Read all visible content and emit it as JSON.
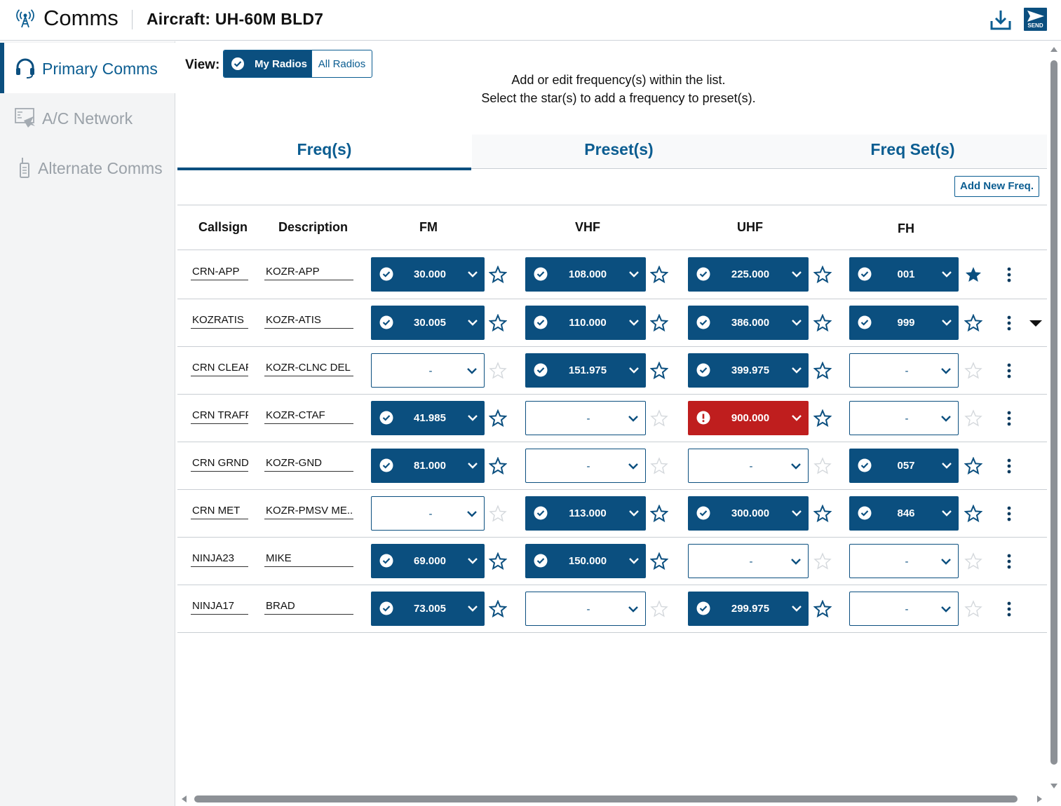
{
  "header": {
    "app_title": "Comms",
    "aircraft": "Aircraft: UH-60M BLD7",
    "send_label": "SEND",
    "icons": [
      "antenna-icon",
      "download-icon",
      "send-icon"
    ]
  },
  "sidebar": {
    "items": [
      {
        "label": "Primary Comms",
        "active": true,
        "icon": "headset-icon"
      },
      {
        "label": "A/C Network",
        "active": false,
        "icon": "network-icon"
      },
      {
        "label": "Alternate Comms",
        "active": false,
        "icon": "radio-handset-icon"
      }
    ]
  },
  "view": {
    "label": "View:",
    "options": [
      "My Radios",
      "All Radios"
    ],
    "selected": "My Radios"
  },
  "instructions": {
    "line1": "Add or edit frequency(s) within the list.",
    "line2": "Select the star(s) to add a frequency to preset(s)."
  },
  "tabs": [
    "Freq(s)",
    "Preset(s)",
    "Freq Set(s)"
  ],
  "active_tab": "Freq(s)",
  "add_button": "Add New Freq.",
  "columns": [
    "Callsign",
    "Description",
    "FM",
    "VHF",
    "UHF",
    "FH"
  ],
  "colors": {
    "primary": "#0b4f7f",
    "error": "#bf1e1e",
    "inactive": "#9aa1a8"
  },
  "rows": [
    {
      "callsign": "CRN-APP",
      "description": "KOZR-APP",
      "fm": {
        "value": "30.000",
        "state": "set",
        "starred": false
      },
      "vhf": {
        "value": "108.000",
        "state": "set",
        "starred": false
      },
      "uhf": {
        "value": "225.000",
        "state": "set",
        "starred": false
      },
      "fh": {
        "value": "001",
        "state": "set",
        "starred": true
      }
    },
    {
      "callsign": "KOZRATIS",
      "description": "KOZR-ATIS",
      "fm": {
        "value": "30.005",
        "state": "set",
        "starred": false
      },
      "vhf": {
        "value": "110.000",
        "state": "set",
        "starred": false
      },
      "uhf": {
        "value": "386.000",
        "state": "set",
        "starred": false
      },
      "fh": {
        "value": "999",
        "state": "set",
        "starred": false
      }
    },
    {
      "callsign": "CRN CLEAR",
      "description": "KOZR-CLNC DEL",
      "fm": {
        "value": "-",
        "state": "empty",
        "starred": false
      },
      "vhf": {
        "value": "151.975",
        "state": "set",
        "starred": false
      },
      "uhf": {
        "value": "399.975",
        "state": "set",
        "starred": false
      },
      "fh": {
        "value": "-",
        "state": "empty",
        "starred": false
      }
    },
    {
      "callsign": "CRN TRAFF",
      "description": "KOZR-CTAF",
      "fm": {
        "value": "41.985",
        "state": "set",
        "starred": false
      },
      "vhf": {
        "value": "-",
        "state": "empty",
        "starred": false
      },
      "uhf": {
        "value": "900.000",
        "state": "error",
        "starred": false
      },
      "fh": {
        "value": "-",
        "state": "empty",
        "starred": false
      }
    },
    {
      "callsign": "CRN GRND",
      "description": "KOZR-GND",
      "fm": {
        "value": "81.000",
        "state": "set",
        "starred": false
      },
      "vhf": {
        "value": "-",
        "state": "empty",
        "starred": false
      },
      "uhf": {
        "value": "-",
        "state": "empty",
        "starred": false
      },
      "fh": {
        "value": "057",
        "state": "set",
        "starred": false
      }
    },
    {
      "callsign": "CRN MET",
      "description": "KOZR-PMSV ME...",
      "fm": {
        "value": "-",
        "state": "empty",
        "starred": false
      },
      "vhf": {
        "value": "113.000",
        "state": "set",
        "starred": false
      },
      "uhf": {
        "value": "300.000",
        "state": "set",
        "starred": false
      },
      "fh": {
        "value": "846",
        "state": "set",
        "starred": false
      }
    },
    {
      "callsign": "NINJA23",
      "description": "MIKE",
      "fm": {
        "value": "69.000",
        "state": "set",
        "starred": false
      },
      "vhf": {
        "value": "150.000",
        "state": "set",
        "starred": false
      },
      "uhf": {
        "value": "-",
        "state": "empty",
        "starred": false
      },
      "fh": {
        "value": "-",
        "state": "empty",
        "starred": false
      }
    },
    {
      "callsign": "NINJA17",
      "description": "BRAD",
      "fm": {
        "value": "73.005",
        "state": "set",
        "starred": false
      },
      "vhf": {
        "value": "-",
        "state": "empty",
        "starred": false
      },
      "uhf": {
        "value": "299.975",
        "state": "set",
        "starred": false
      },
      "fh": {
        "value": "-",
        "state": "empty",
        "starred": false
      }
    }
  ]
}
